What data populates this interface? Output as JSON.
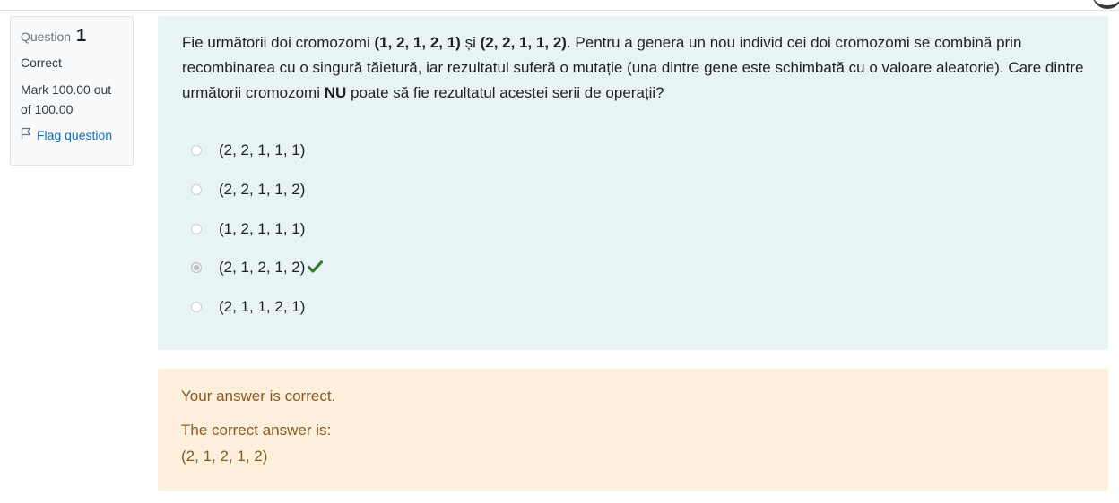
{
  "info": {
    "question_label": "Question",
    "question_number": "1",
    "state": "Correct",
    "grade": "Mark 100.00 out of 100.00",
    "flag_label": "Flag question"
  },
  "question": {
    "text_parts": [
      "Fie următorii doi cromozomi ",
      "(1, 2, 1, 2, 1)",
      " și ",
      "(2, 2, 1, 1, 2)",
      ". Pentru a genera un nou individ cei doi cromozomi se combină prin recombinarea cu o singură tăietură, iar rezultatul suferă o mutație (una dintre gene este schimbată cu o valoare aleatorie). Care dintre următorii cromozomi ",
      "NU",
      " poate să fie rezultatul acestei serii de operații?"
    ],
    "answers": [
      {
        "label": "(2, 2, 1, 1, 1)",
        "checked": false
      },
      {
        "label": "(2, 2, 1, 1, 2)",
        "checked": false
      },
      {
        "label": "(1, 2, 1, 1, 1)",
        "checked": false
      },
      {
        "label": "(2, 1, 2, 1, 2)",
        "checked": true,
        "mark_icon": "check-icon",
        "mark_color": "#357a32"
      },
      {
        "label": "(2, 1, 1, 2, 1)",
        "checked": false
      }
    ]
  },
  "feedback": {
    "result": "Your answer is correct.",
    "correct_answer_label": "The correct answer is:",
    "correct_answer": "(2, 1, 2, 1, 2)"
  },
  "colors": {
    "question_bg": "#e7f3f5",
    "feedback_bg": "#fcefdc",
    "feedback_text": "#8a5a1f",
    "link": "#0f6cbf"
  }
}
